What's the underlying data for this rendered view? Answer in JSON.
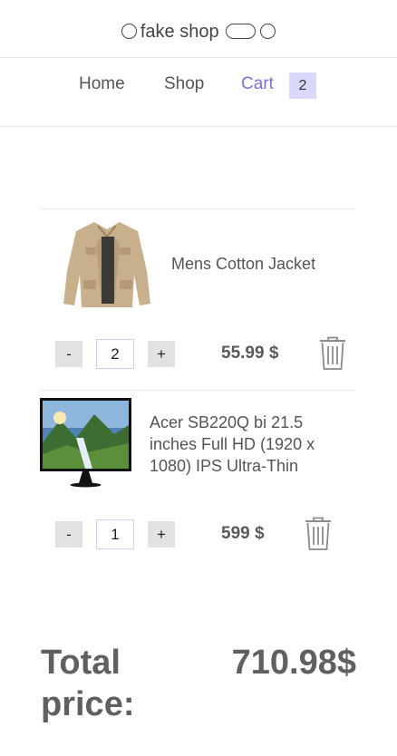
{
  "header": {
    "logo_text": "fake shop"
  },
  "nav": {
    "home": "Home",
    "shop": "Shop",
    "cart": "Cart",
    "cart_count": "2"
  },
  "cart": {
    "items": [
      {
        "name": "Mens Cotton Jacket",
        "quantity": "2",
        "price": "55.99 $",
        "minus": "-",
        "plus": "+",
        "image": "jacket-image"
      },
      {
        "name": "Acer SB220Q bi 21.5 inches Full HD (1920 x 1080) IPS Ultra-Thin",
        "quantity": "1",
        "price": "599 $",
        "minus": "-",
        "plus": "+",
        "image": "monitor-image"
      }
    ]
  },
  "total": {
    "label": "Total price:",
    "value": "710.98$"
  },
  "colors": {
    "accent": "#7b74d6",
    "badge_bg": "#d9d8fb",
    "text": "#5a5a5a"
  },
  "icons": [
    "trash-icon",
    "circle-icon",
    "pill-icon"
  ]
}
